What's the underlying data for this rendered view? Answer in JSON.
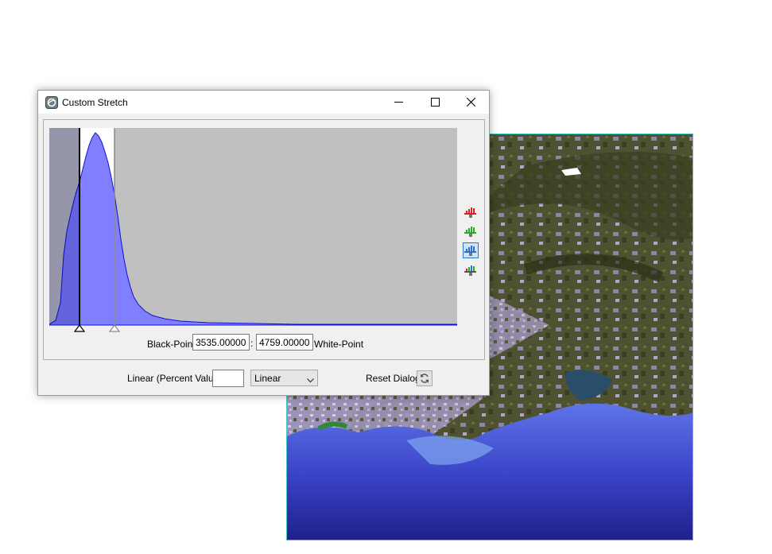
{
  "window": {
    "title": "Custom Stretch",
    "app_icon": "envi-app-icon",
    "controls": [
      "minimize-icon",
      "maximize-icon",
      "close-icon"
    ]
  },
  "histogram": {
    "selected_band": "blue",
    "band_buttons": [
      "red-band-icon",
      "green-band-icon",
      "blue-band-icon",
      "all-bands-icon"
    ],
    "colors": {
      "plot_background": "#c0c0c0",
      "highlight_background": "#ffffff",
      "histogram_fill": "#7f7fff",
      "histogram_outline": "#1010d8",
      "red": "#e02020",
      "green": "#20b020",
      "blue": "#2a6fd1"
    }
  },
  "black_point": {
    "label": "Black-Point",
    "value": "3535.00000"
  },
  "separator": ":",
  "white_point": {
    "label": "White-Point",
    "value": "4759.00000"
  },
  "bottom": {
    "linear_label": "Linear (Percent Value)",
    "percent_value": "",
    "stretch_type": "Linear",
    "reset_label": "Reset Dialog",
    "reset_icon": "refresh-icon"
  }
}
